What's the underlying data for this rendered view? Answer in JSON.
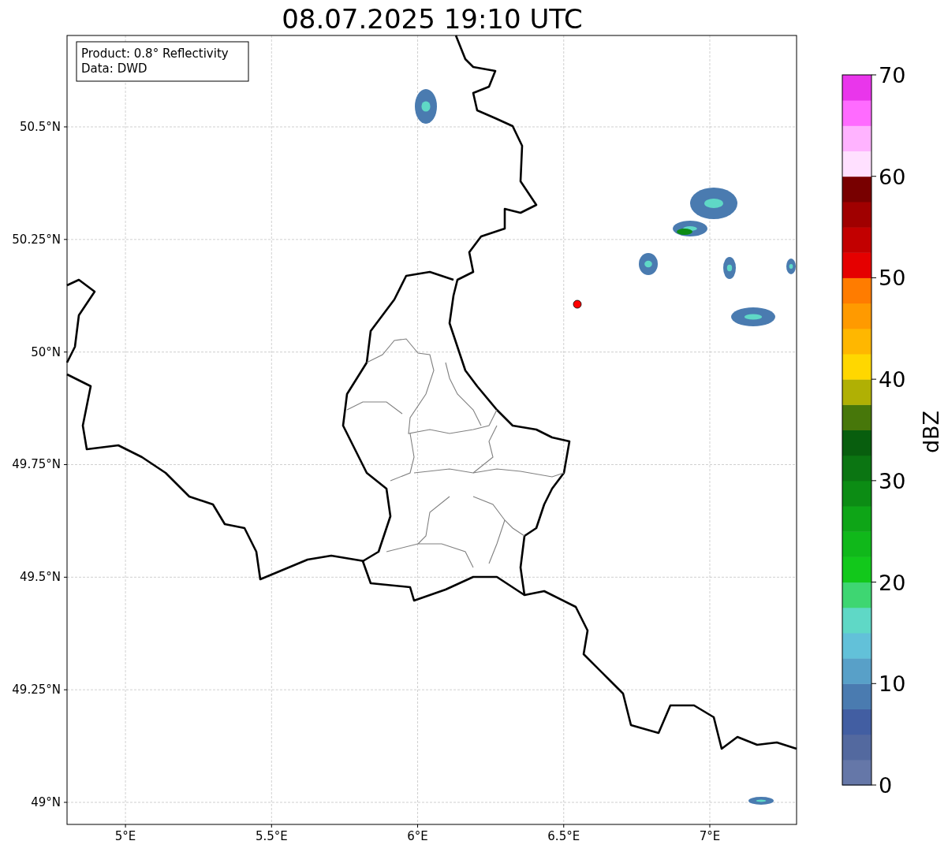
{
  "title": "08.07.2025 19:10 UTC",
  "info_box": [
    "Product: 0.8° Reflectivity",
    "Data: DWD"
  ],
  "axes": {
    "xticks": [
      "5°E",
      "5.5°E",
      "6°E",
      "6.5°E",
      "7°E"
    ],
    "yticks": [
      "50.5°N",
      "50.25°N",
      "50°N",
      "49.75°N",
      "49.5°N",
      "49.25°N",
      "49°N"
    ]
  },
  "colorbar": {
    "label": "dBZ",
    "ticks": [
      "70",
      "60",
      "50",
      "40",
      "30",
      "20",
      "10",
      "0"
    ]
  }
}
